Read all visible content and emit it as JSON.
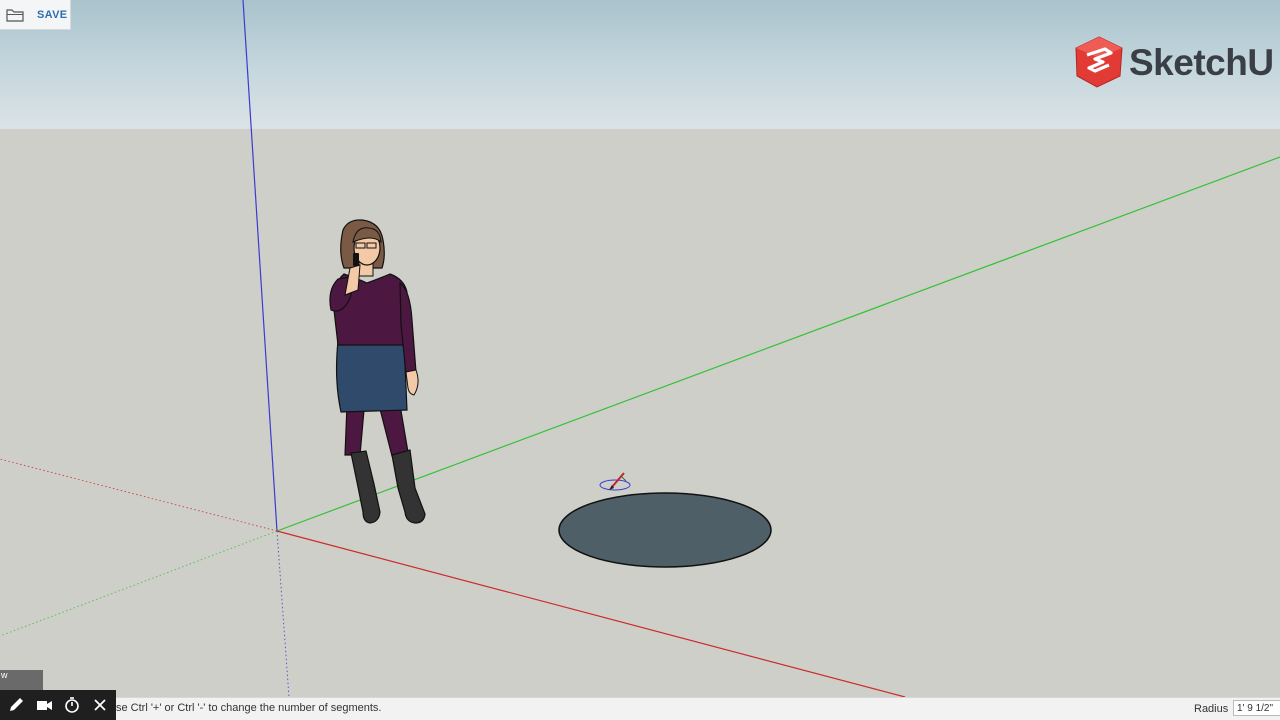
{
  "app": {
    "save_label": "SAVE",
    "logo_text": "SketchU"
  },
  "icons": {
    "save": "folder-icon",
    "logo": "sketchup-logo-icon",
    "pencil": "pencil-icon",
    "camera": "video-camera-icon",
    "timer": "stopwatch-icon",
    "close": "close-icon",
    "cursor": "circle-tool-cursor-icon"
  },
  "colors": {
    "sky_top": "#a9c3cc",
    "ground": "#cfcfca",
    "axis_blue": "#3b3bd0",
    "axis_green": "#33c233",
    "axis_red": "#cc2b2b",
    "circle_fill": "#4f5f67",
    "link_blue": "#2c6fb0",
    "logo_red": "#e23b36"
  },
  "statusbar": {
    "hint": "se Ctrl '+' or Ctrl '-' to change the number of segments.",
    "measure_label": "Radius",
    "measure_value": "1' 9 1/2\""
  },
  "recorder": {
    "tab_label": "w"
  }
}
